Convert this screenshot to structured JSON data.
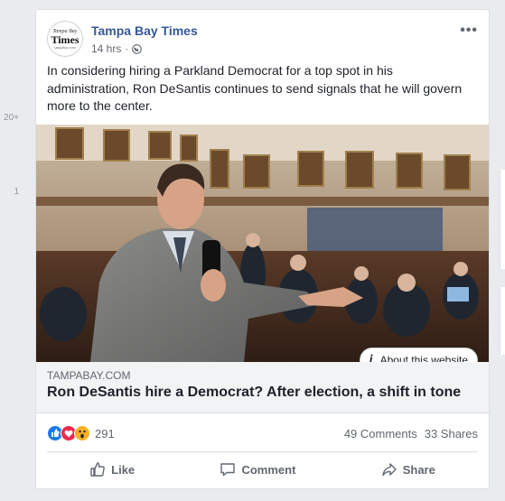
{
  "side_counts": [
    "20+",
    "1"
  ],
  "post": {
    "page_name": "Tampa Bay Times",
    "time": "14 hrs",
    "privacy_icon": "globe-icon",
    "more_icon": "more-options-icon",
    "avatar": {
      "line1": "Tampa Bay",
      "line2": "Times",
      "line3": "tampabay.com"
    },
    "caption": "In considering hiring a Parkland Democrat for a top spot in his administration, Ron DeSantis continues to send signals that he will govern more to the center.",
    "about_label": "About this website",
    "link": {
      "domain": "TAMPABAY.COM",
      "headline": "Ron DeSantis hire a Democrat? After election, a shift in tone"
    },
    "reactions": {
      "icons": [
        "like-reaction-icon",
        "love-reaction-icon",
        "wow-reaction-icon"
      ],
      "count": "291",
      "comments": "49 Comments",
      "shares": "33 Shares"
    },
    "actions": {
      "like": "Like",
      "comment": "Comment",
      "share": "Share"
    }
  },
  "colors": {
    "link_blue": "#365899",
    "muted": "#606770",
    "page_bg": "#e9ebee",
    "like_blue": "#1877f2",
    "love_red": "#f0284a",
    "wow_yellow": "#f7b125"
  }
}
